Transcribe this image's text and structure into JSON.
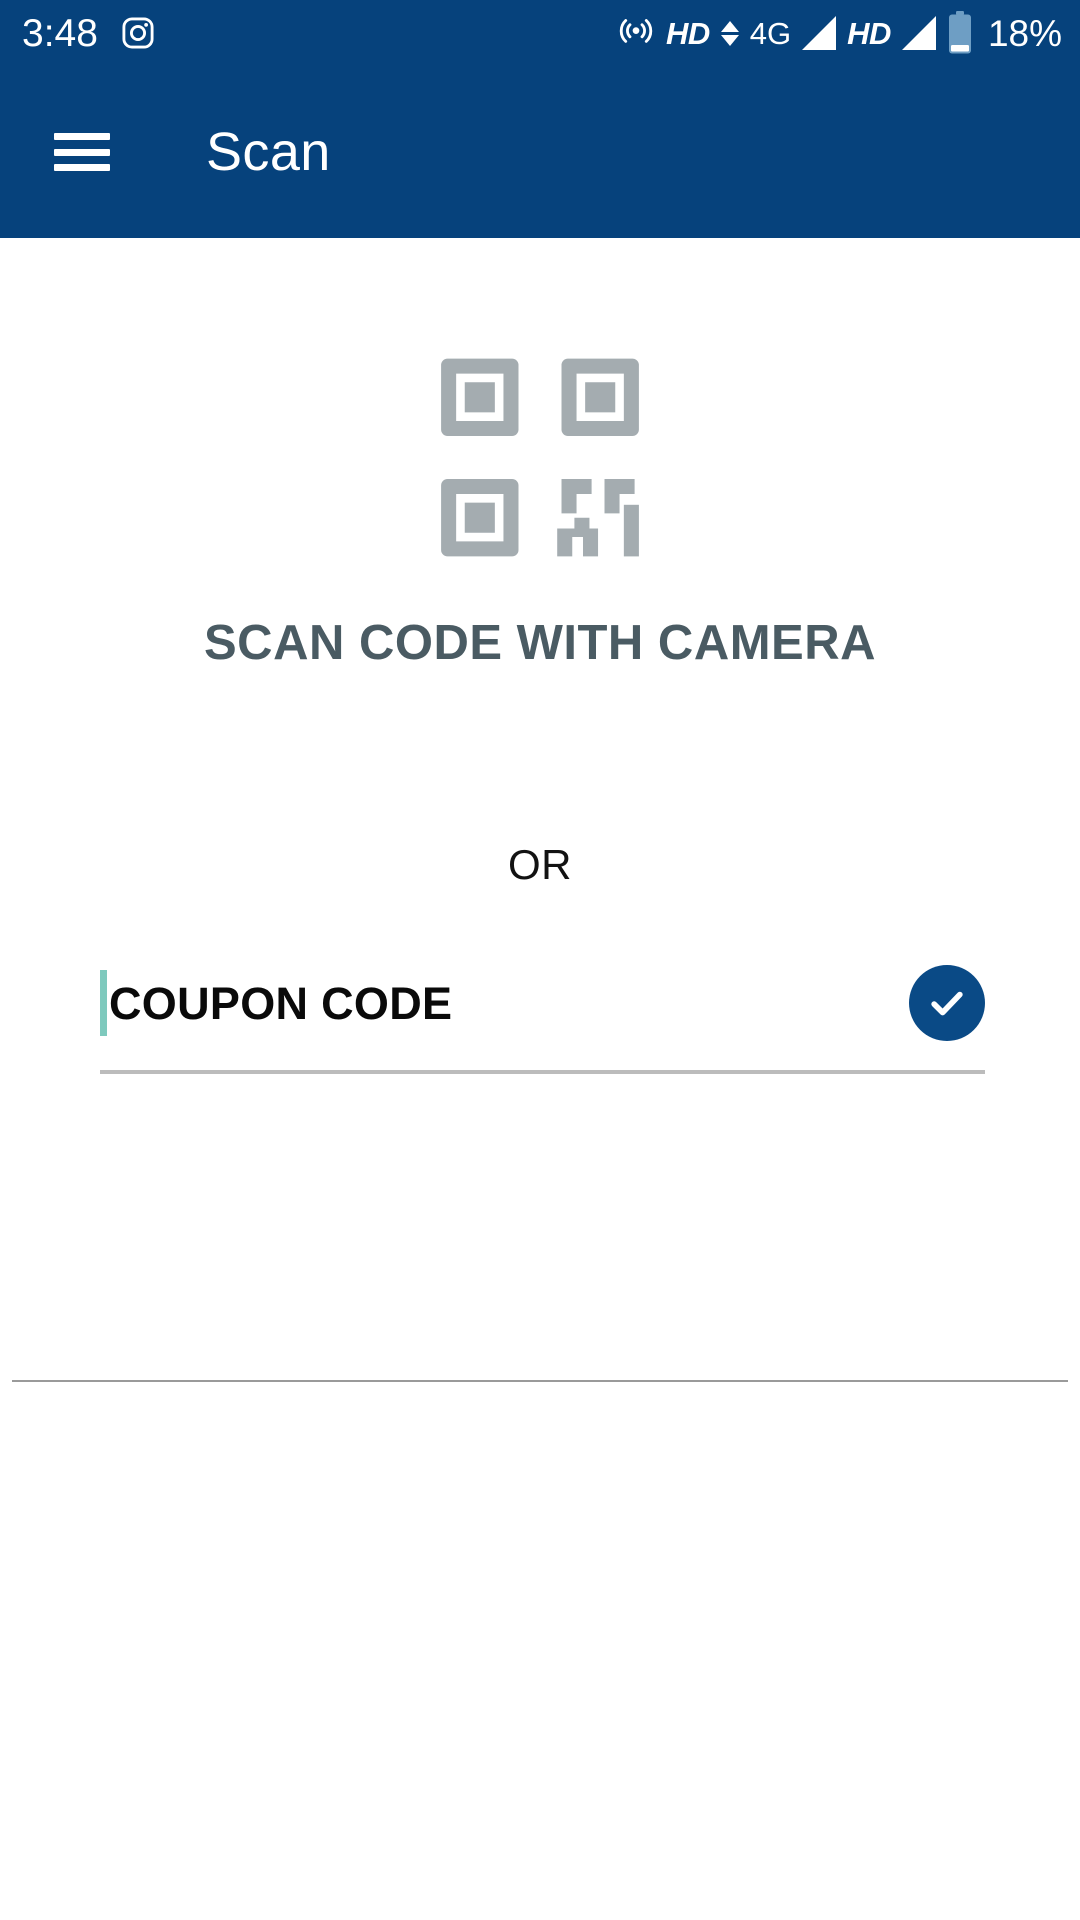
{
  "status_bar": {
    "clock": "3:48",
    "notification_icon": "instagram-icon",
    "hotspot_icon": "hotspot-icon",
    "hd_label_1": "HD",
    "data_arrows_icon": "data-transfer-arrows-icon",
    "network_type": "4G",
    "signal_icon_1": "signal-bars-icon",
    "hd_label_2": "HD",
    "signal_icon_2": "signal-bars-icon",
    "battery_icon": "battery-icon",
    "battery_percent": "18%",
    "background_color": "#06427c",
    "foreground_color": "#ffffff"
  },
  "app_bar": {
    "menu_icon": "hamburger-menu-icon",
    "title": "Scan",
    "background_color": "#06427c",
    "title_color": "#ffffff"
  },
  "main": {
    "qr_icon": "qr-code-icon",
    "qr_icon_color": "#a4acb0",
    "scan_heading": "SCAN CODE WITH CAMERA",
    "scan_heading_color": "#4a5b63",
    "or_label": "OR",
    "coupon": {
      "value": "COUPON CODE",
      "placeholder": "COUPON CODE",
      "caret_color": "#7ec9bd",
      "submit_icon": "checkmark-icon",
      "submit_color": "#0a4a86"
    },
    "divider_color": "#bcbcbc",
    "section_divider_color": "#9a9a9a"
  }
}
